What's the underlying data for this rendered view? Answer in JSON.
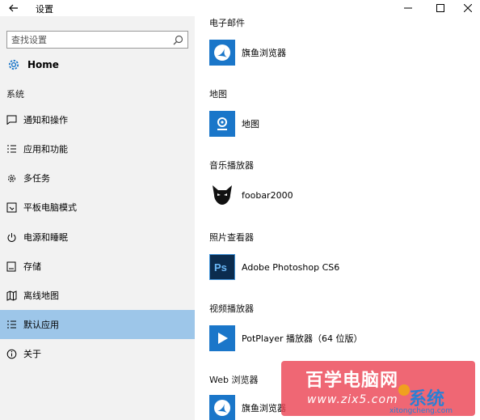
{
  "window": {
    "title": "设置",
    "back_icon": "back-arrow-icon",
    "minimize_icon": "minimize-icon",
    "maximize_icon": "maximize-icon",
    "close_icon": "close-icon"
  },
  "sidebar": {
    "search_placeholder": "查找设置",
    "home_label": "Home",
    "section_label": "系统",
    "items": [
      {
        "label": "通知和操作",
        "icon": "message-icon"
      },
      {
        "label": "应用和功能",
        "icon": "list-icon"
      },
      {
        "label": "多任务",
        "icon": "multitask-icon"
      },
      {
        "label": "平板电脑模式",
        "icon": "tablet-icon"
      },
      {
        "label": "电源和睡眠",
        "icon": "power-icon"
      },
      {
        "label": "存储",
        "icon": "storage-icon"
      },
      {
        "label": "离线地图",
        "icon": "map-icon"
      },
      {
        "label": "默认应用",
        "icon": "default-apps-icon",
        "selected": true
      },
      {
        "label": "关于",
        "icon": "info-icon"
      }
    ]
  },
  "content": {
    "categories": [
      {
        "label": "电子邮件",
        "app": "旗鱼浏览器",
        "icon": "browser-icon"
      },
      {
        "label": "地图",
        "app": "地图",
        "icon": "maps-app-icon"
      },
      {
        "label": "音乐播放器",
        "app": "foobar2000",
        "icon": "foobar-icon"
      },
      {
        "label": "照片查看器",
        "app": "Adobe Photoshop CS6",
        "icon": "photoshop-icon"
      },
      {
        "label": "视频播放器",
        "app": "PotPlayer 播放器（64 位版）",
        "icon": "play-icon"
      },
      {
        "label": "Web 浏览器",
        "app": "旗鱼浏览器",
        "icon": "browser-icon"
      }
    ]
  },
  "watermark": {
    "title": "百学电脑网",
    "url": "www.zix5.com",
    "badge": "系统城",
    "badge_url": "xitongcheng.com"
  },
  "colors": {
    "sidebar_bg": "#f2f2f2",
    "selected_bg": "#9dc6e9",
    "app_icon_bg": "#1a76c9",
    "photoshop_bg": "#0b2c4e"
  }
}
